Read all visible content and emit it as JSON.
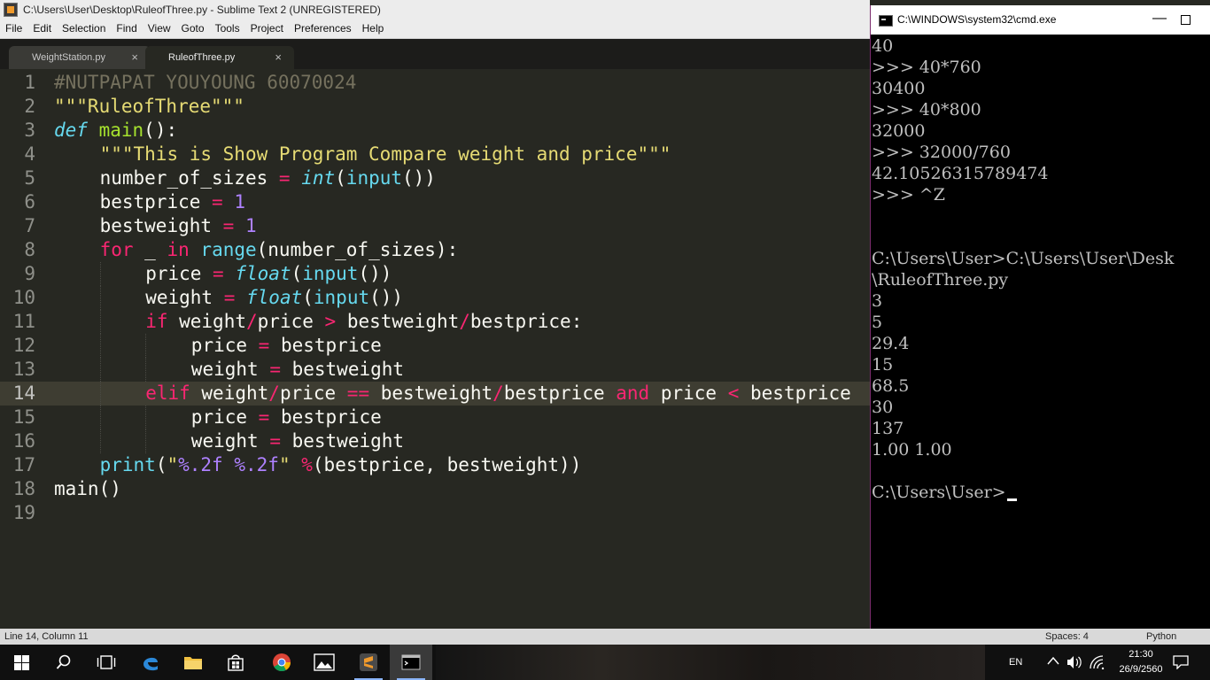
{
  "sublime": {
    "title": "C:\\Users\\User\\Desktop\\RuleofThree.py - Sublime Text 2 (UNREGISTERED)",
    "menu": [
      "File",
      "Edit",
      "Selection",
      "Find",
      "View",
      "Goto",
      "Tools",
      "Project",
      "Preferences",
      "Help"
    ],
    "tabs": [
      {
        "label": "WeightStation.py",
        "active": false
      },
      {
        "label": "RuleofThree.py",
        "active": true
      }
    ],
    "tab_close": "×",
    "current_line": 14,
    "lines": [
      {
        "n": "1",
        "indent": 0,
        "tokens": [
          [
            "c-com",
            "#NUTPAPAT YOUYOUNG 60070024"
          ]
        ]
      },
      {
        "n": "2",
        "indent": 0,
        "tokens": [
          [
            "c-str",
            "\"\"\"RuleofThree\"\"\""
          ]
        ]
      },
      {
        "n": "3",
        "indent": 0,
        "tokens": [
          [
            "c-def",
            "def"
          ],
          [
            "",
            " "
          ],
          [
            "c-fn",
            "main"
          ],
          [
            "",
            "():"
          ]
        ]
      },
      {
        "n": "4",
        "indent": 1,
        "tokens": [
          [
            "c-str",
            "\"\"\"This is Show Program Compare weight and price\"\"\""
          ]
        ]
      },
      {
        "n": "5",
        "indent": 1,
        "tokens": [
          [
            "",
            "number_of_sizes "
          ],
          [
            "c-op",
            "="
          ],
          [
            "",
            " "
          ],
          [
            "c-bit",
            "int"
          ],
          [
            "",
            "("
          ],
          [
            "c-bi",
            "input"
          ],
          [
            "",
            "())"
          ]
        ]
      },
      {
        "n": "6",
        "indent": 1,
        "tokens": [
          [
            "",
            "bestprice "
          ],
          [
            "c-op",
            "="
          ],
          [
            "",
            " "
          ],
          [
            "c-num",
            "1"
          ]
        ]
      },
      {
        "n": "7",
        "indent": 1,
        "tokens": [
          [
            "",
            "bestweight "
          ],
          [
            "c-op",
            "="
          ],
          [
            "",
            " "
          ],
          [
            "c-num",
            "1"
          ]
        ]
      },
      {
        "n": "8",
        "indent": 1,
        "tokens": [
          [
            "c-kw",
            "for"
          ],
          [
            "",
            " _ "
          ],
          [
            "c-kw",
            "in"
          ],
          [
            "",
            " "
          ],
          [
            "c-bi",
            "range"
          ],
          [
            "",
            "(number_of_sizes):"
          ]
        ]
      },
      {
        "n": "9",
        "indent": 2,
        "tokens": [
          [
            "",
            "price "
          ],
          [
            "c-op",
            "="
          ],
          [
            "",
            " "
          ],
          [
            "c-bit",
            "float"
          ],
          [
            "",
            "("
          ],
          [
            "c-bi",
            "input"
          ],
          [
            "",
            "())"
          ]
        ]
      },
      {
        "n": "10",
        "indent": 2,
        "tokens": [
          [
            "",
            "weight "
          ],
          [
            "c-op",
            "="
          ],
          [
            "",
            " "
          ],
          [
            "c-bit",
            "float"
          ],
          [
            "",
            "("
          ],
          [
            "c-bi",
            "input"
          ],
          [
            "",
            "())"
          ]
        ]
      },
      {
        "n": "11",
        "indent": 2,
        "tokens": [
          [
            "c-kw",
            "if"
          ],
          [
            "",
            " weight"
          ],
          [
            "c-op",
            "/"
          ],
          [
            "",
            "price "
          ],
          [
            "c-op",
            ">"
          ],
          [
            "",
            " bestweight"
          ],
          [
            "c-op",
            "/"
          ],
          [
            "",
            "bestprice:"
          ]
        ]
      },
      {
        "n": "12",
        "indent": 3,
        "tokens": [
          [
            "",
            "price "
          ],
          [
            "c-op",
            "="
          ],
          [
            "",
            " bestprice"
          ]
        ]
      },
      {
        "n": "13",
        "indent": 3,
        "tokens": [
          [
            "",
            "weight "
          ],
          [
            "c-op",
            "="
          ],
          [
            "",
            " bestweight"
          ]
        ]
      },
      {
        "n": "14",
        "indent": 2,
        "tokens": [
          [
            "c-kw",
            "elif"
          ],
          [
            "",
            " weight"
          ],
          [
            "c-op",
            "/"
          ],
          [
            "",
            "price "
          ],
          [
            "c-op",
            "=="
          ],
          [
            "",
            " bestweight"
          ],
          [
            "c-op",
            "/"
          ],
          [
            "",
            "bestprice "
          ],
          [
            "c-kw",
            "and"
          ],
          [
            "",
            " price "
          ],
          [
            "c-op",
            "<"
          ],
          [
            "",
            " bestprice"
          ]
        ]
      },
      {
        "n": "15",
        "indent": 3,
        "tokens": [
          [
            "",
            "price "
          ],
          [
            "c-op",
            "="
          ],
          [
            "",
            " bestprice"
          ]
        ]
      },
      {
        "n": "16",
        "indent": 3,
        "tokens": [
          [
            "",
            "weight "
          ],
          [
            "c-op",
            "="
          ],
          [
            "",
            " bestweight"
          ]
        ]
      },
      {
        "n": "17",
        "indent": 1,
        "tokens": [
          [
            "c-bi",
            "print"
          ],
          [
            "",
            "("
          ],
          [
            "c-str",
            "\""
          ],
          [
            "c-fmt",
            "%.2f"
          ],
          [
            "c-str",
            " "
          ],
          [
            "c-fmt",
            "%.2f"
          ],
          [
            "c-str",
            "\""
          ],
          [
            "",
            " "
          ],
          [
            "c-op",
            "%"
          ],
          [
            "",
            "(bestprice, bestweight))"
          ]
        ]
      },
      {
        "n": "18",
        "indent": 0,
        "tokens": [
          [
            "",
            "main()"
          ]
        ]
      },
      {
        "n": "19",
        "indent": 0,
        "tokens": []
      }
    ],
    "status": {
      "position": "Line 14, Column 11",
      "spaces": "Spaces: 4",
      "syntax": "Python"
    }
  },
  "cmd": {
    "title": "C:\\WINDOWS\\system32\\cmd.exe",
    "min_glyph": "—",
    "lines": [
      "40",
      ">>> 40*760",
      "30400",
      ">>> 40*800",
      "32000",
      ">>> 32000/760",
      "42.10526315789474",
      ">>> ^Z",
      "",
      "",
      "C:\\Users\\User>C:\\Users\\User\\Desk",
      "\\RuleofThree.py",
      "3",
      "5",
      "29.4",
      "15",
      "68.5",
      "30",
      "137",
      "1.00 1.00",
      "",
      "C:\\Users\\User>"
    ]
  },
  "taskbar": {
    "language": "EN",
    "time": "21:30",
    "date": "26/9/2560"
  },
  "colors": {
    "editor_bg": "#272822",
    "keyword": "#f92672",
    "string": "#e6db74",
    "function": "#a6e22e",
    "builtin": "#66d9ef",
    "number": "#ae81ff",
    "comment": "#75715e"
  }
}
